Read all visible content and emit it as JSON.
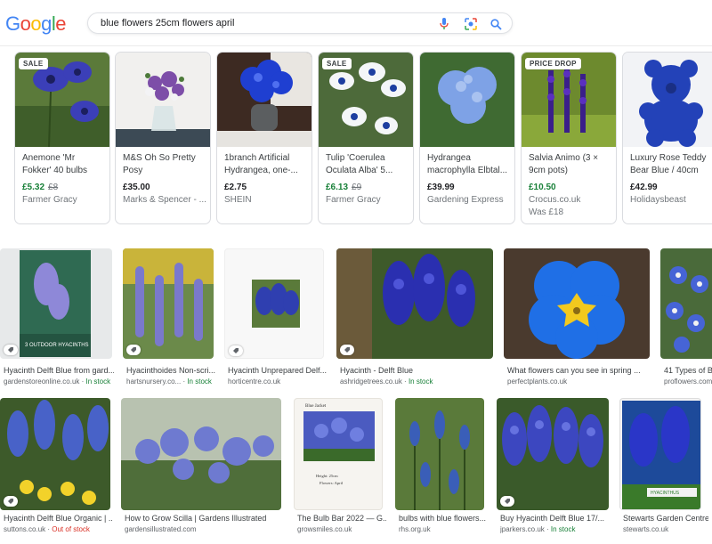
{
  "search": {
    "query": "blue flowers 25cm flowers april"
  },
  "logo": {
    "letters": [
      "G",
      "o",
      "o",
      "g",
      "l",
      "e"
    ]
  },
  "colors": {
    "google_blue": "#4285F4",
    "google_red": "#EA4335",
    "google_yellow": "#FBBC05",
    "google_green": "#34A853",
    "price_green": "#188038",
    "stock_red": "#d93025"
  },
  "shopping": [
    {
      "badge": "SALE",
      "title": "Anemone 'Mr Fokker' 40 bulbs",
      "price": "£5.32",
      "old": "£8",
      "store": "Farmer Gracy",
      "extra": ""
    },
    {
      "badge": "",
      "title": "M&S Oh So Pretty Posy",
      "price": "£35.00",
      "old": "",
      "store": "Marks & Spencer - ...",
      "extra": ""
    },
    {
      "badge": "",
      "title": "1branch Artificial Hydrangea, one-...",
      "price": "£2.75",
      "old": "",
      "store": "SHEIN",
      "extra": ""
    },
    {
      "badge": "SALE",
      "title": "Tulip 'Coerulea Oculata Alba' 5...",
      "price": "£6.13",
      "old": "£9",
      "store": "Farmer Gracy",
      "extra": ""
    },
    {
      "badge": "",
      "title": "Hydrangea macrophylla Elbtal...",
      "price": "£39.99",
      "old": "",
      "store": "Gardening Express",
      "extra": ""
    },
    {
      "badge": "PRICE DROP",
      "title": "Salvia Animo (3 × 9cm pots)",
      "price": "£10.50",
      "old": "",
      "store": "Crocus.co.uk",
      "extra": "Was £18"
    },
    {
      "badge": "",
      "title": "Luxury Rose Teddy Bear Blue / 40cm",
      "price": "£42.99",
      "old": "",
      "store": "Holidaysbeast",
      "extra": ""
    }
  ],
  "row1": [
    {
      "caption": "Hyacinth Delft Blue from gard...",
      "source": "gardenstoreonline.co.uk",
      "stock": "In stock"
    },
    {
      "caption": "Hyacinthoides Non-scri...",
      "source": "hartsnursery.co...",
      "stock": "In stock"
    },
    {
      "caption": "Hyacinth Unprepared Delf...",
      "source": "horticentre.co.uk",
      "stock": ""
    },
    {
      "caption": "Hyacinth - Delft Blue",
      "source": "ashridgetrees.co.uk",
      "stock": "In stock"
    },
    {
      "caption": "What flowers can you see in spring ...",
      "source": "perfectplants.co.uk",
      "stock": ""
    },
    {
      "caption": "41 Types of Bl",
      "source": "proflowers.com",
      "stock": ""
    }
  ],
  "row2": [
    {
      "caption": "Hyacinth Delft Blue Organic | ...",
      "source": "suttons.co.uk",
      "stock": "Out of stock"
    },
    {
      "caption": "How to Grow Scilla | Gardens Illustrated",
      "source": "gardensillustrated.com",
      "stock": ""
    },
    {
      "caption": "The Bulb Bar 2022 — G...",
      "source": "growsmiles.co.uk",
      "stock": ""
    },
    {
      "caption": "bulbs with blue flowers...",
      "source": "rhs.org.uk",
      "stock": ""
    },
    {
      "caption": "Buy Hyacinth Delft Blue 17/...",
      "source": "jparkers.co.uk",
      "stock": "In stock"
    },
    {
      "caption": "Stewarts Garden Centre",
      "source": "stewarts.co.uk",
      "stock": ""
    }
  ],
  "packet_texts": {
    "hyacinth_packet": "3 OUTDOOR HYACINTHS",
    "bulb_bar_header": "Blue Jacket",
    "bulb_bar_line1": "Height: 25cm",
    "bulb_bar_line2": "Flowers: April",
    "hyacinthus_label": "HYACINTHUS"
  },
  "stock_separator": " · "
}
